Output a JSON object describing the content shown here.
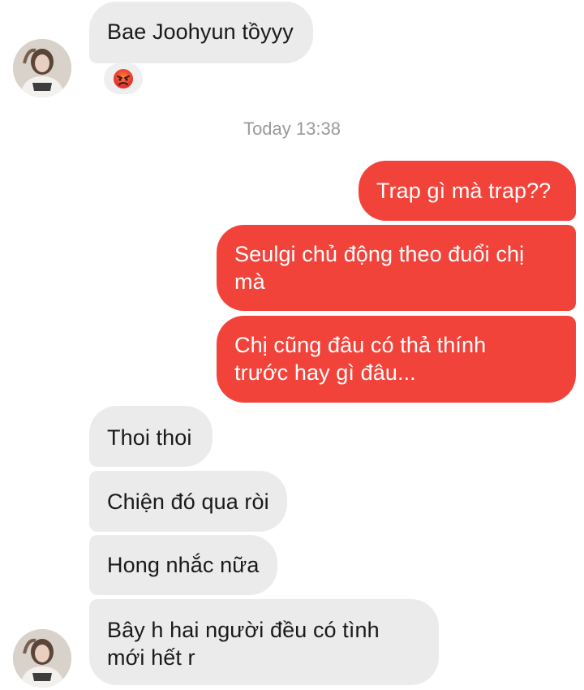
{
  "timestamp": "Today 13:38",
  "reaction_icon": "angry-face-icon",
  "messages": {
    "m1": "Bae Joohyun tồyyy",
    "m2": "Trap gì mà trap??",
    "m3_l1": "Seulgi chủ động theo đuổi chị",
    "m3_l2": "mà",
    "m4_l1": "Chị cũng đâu có thả thính",
    "m4_l2": "trước hay gì đâu...",
    "m5": "Thoi thoi",
    "m6": "Chiện đó qua ròi",
    "m7": "Hong nhắc nữa",
    "m8_l1": "Bây h hai người đều có tình",
    "m8_l2": "mới hết r"
  },
  "colors": {
    "outgoing_bubble": "#f2433b",
    "incoming_bubble": "#ebebeb",
    "timestamp_text": "#9a9a9a"
  }
}
